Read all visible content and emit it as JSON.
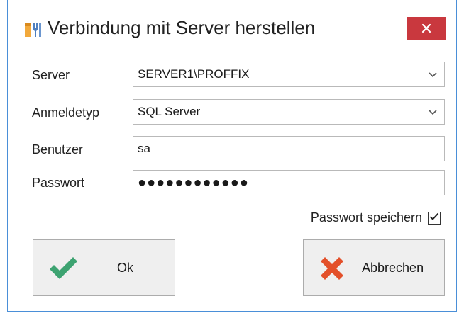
{
  "window": {
    "title": "Verbindung mit Server herstellen",
    "icon": "tools-icon",
    "close_icon": "close-icon"
  },
  "form": {
    "server": {
      "label": "Server",
      "value": "SERVER1\\PROFFIX"
    },
    "login_type": {
      "label": "Anmeldetyp",
      "value": "SQL Server"
    },
    "user": {
      "label": "Benutzer",
      "value": "sa"
    },
    "password": {
      "label": "Passwort",
      "masked": "●●●●●●●●●●●●"
    },
    "remember": {
      "label": "Passwort speichern",
      "checked": true
    }
  },
  "buttons": {
    "ok": {
      "mnemonic": "O",
      "rest": "k",
      "icon": "checkmark-icon"
    },
    "cancel": {
      "mnemonic": "A",
      "rest": "bbrechen",
      "icon": "cross-icon"
    }
  },
  "colors": {
    "close_button": "#c9383e",
    "window_border": "#4a8fd8",
    "ok_icon": "#3da371",
    "cancel_icon": "#e3502a"
  }
}
